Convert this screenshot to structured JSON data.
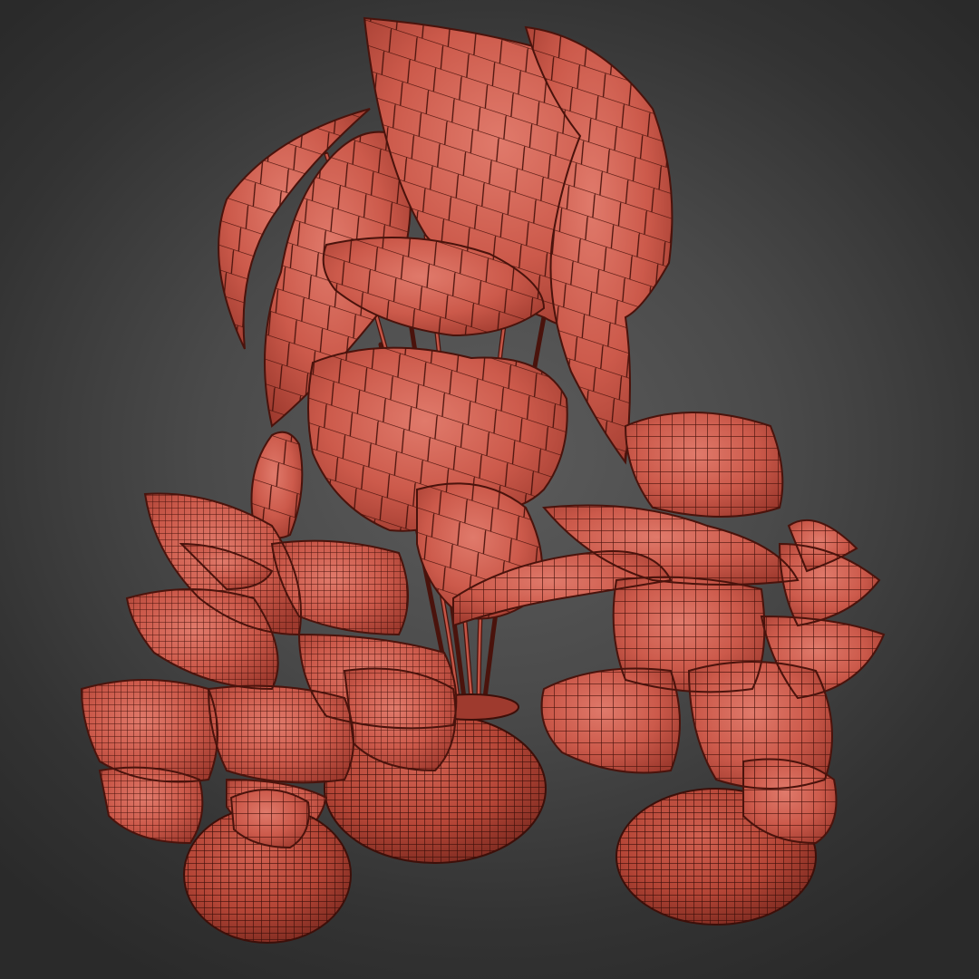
{
  "scene": {
    "render_style": "wireframe-on-shaded",
    "colors": {
      "background_center": "#5c5c5c",
      "background_edge": "#2a2a2a",
      "mesh_light": "#d86b5c",
      "mesh_mid": "#c55546",
      "mesh_dark": "#8f3429",
      "wire": "#4a130c"
    },
    "objects": [
      {
        "name": "large-leaf-plant",
        "pot": "round-basket"
      },
      {
        "name": "small-fern-plant-left",
        "pot": "round-basket"
      },
      {
        "name": "fern-plant-right",
        "pot": "round-basket"
      }
    ]
  }
}
